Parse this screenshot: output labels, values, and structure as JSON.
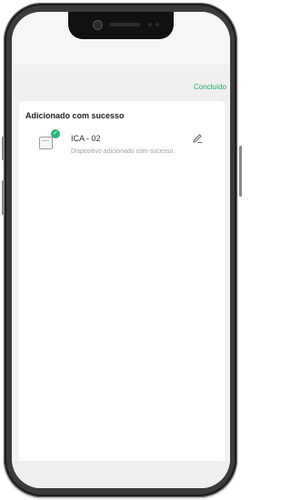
{
  "header": {
    "done_label": "Concluído"
  },
  "main": {
    "title": "Adicionado com sucesso",
    "device": {
      "name": "ICA - 02",
      "status": "Dispositivo adicionado com sucesso."
    }
  },
  "icons": {
    "device": "device-icon",
    "check": "check-circle-icon",
    "edit": "pencil-edit-icon"
  },
  "colors": {
    "accent": "#1faa62",
    "success_badge": "#2ab57d"
  }
}
